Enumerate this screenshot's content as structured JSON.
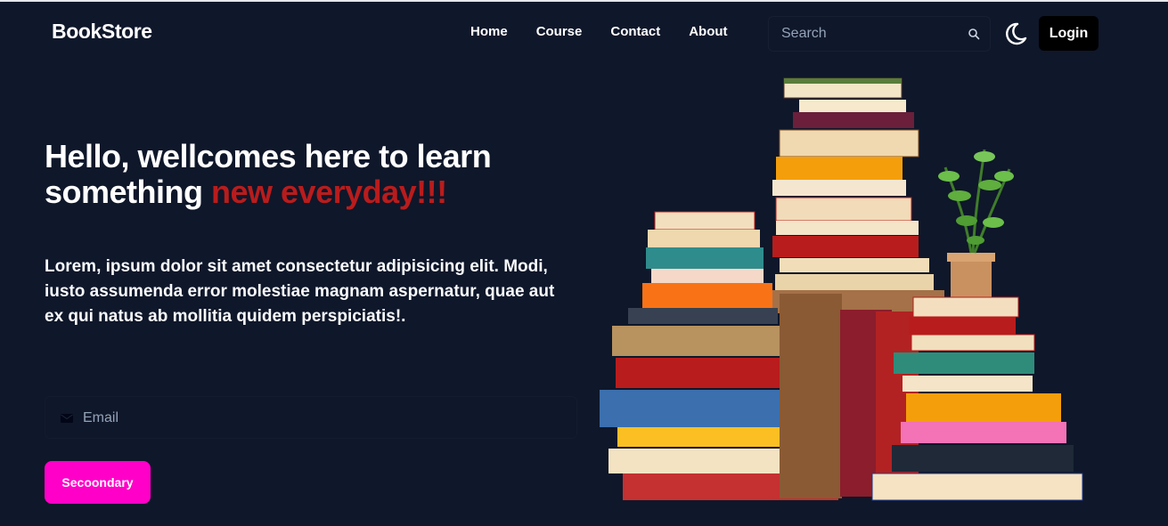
{
  "nav": {
    "brand": "BookStore",
    "links": [
      "Home",
      "Course",
      "Contact",
      "About"
    ],
    "search_placeholder": "Search",
    "login_label": "Login"
  },
  "hero": {
    "title_part1": "Hello, wellcomes here to learn something ",
    "title_accent": "new everyday!!!",
    "description": "Lorem, ipsum dolor sit amet consectetur adipisicing elit. Modi, iusto assumenda error molestiae magnam aspernatur, quae aut ex qui natus ab mollitia quidem perspiciatis!.",
    "email_placeholder": "Email",
    "button_label": "Secoondary"
  },
  "colors": {
    "background": "#0f172a",
    "accent_red": "#b91c1c",
    "button_pink": "#ff00c8"
  },
  "icons": [
    "search-icon",
    "moon-icon",
    "mail-icon"
  ]
}
